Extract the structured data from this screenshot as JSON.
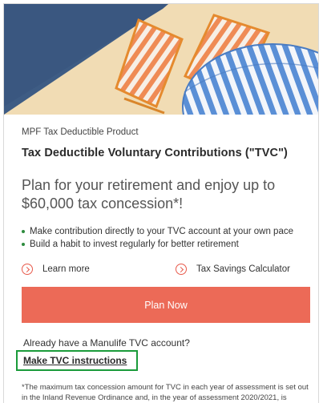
{
  "hero": {
    "image_description_icons": [
      "deck-chair-icon",
      "beach-umbrella-icon"
    ],
    "colors": {
      "sky": "#3e5c84",
      "sand": "#f1dcb4",
      "chair_stripe": "#f0905a",
      "umbrella_blue": "#5a8fd6"
    }
  },
  "product": {
    "eyebrow": "MPF Tax Deductible Product",
    "title": "Tax Deductible Voluntary Contributions (\"TVC\")",
    "tagline": "Plan for your retirement and enjoy up to $60,000 tax concession*!"
  },
  "bullets": [
    "Make contribution directly to your TVC account at your own pace",
    "Build a habit to invest regularly for better retirement"
  ],
  "links": {
    "learn_more": "Learn more",
    "calculator": "Tax Savings Calculator"
  },
  "cta": {
    "plan_now": "Plan Now",
    "color": "#ec6a57"
  },
  "account": {
    "already_text": "Already have a Manulife TVC account?",
    "make_instructions": "Make TVC instructions",
    "highlight_color": "#1a9b3a"
  },
  "footnote": "*The maximum tax concession amount for TVC in each year of assessment is set out in the Inland Revenue Ordinance and, in the year of assessment 2020/2021, is"
}
